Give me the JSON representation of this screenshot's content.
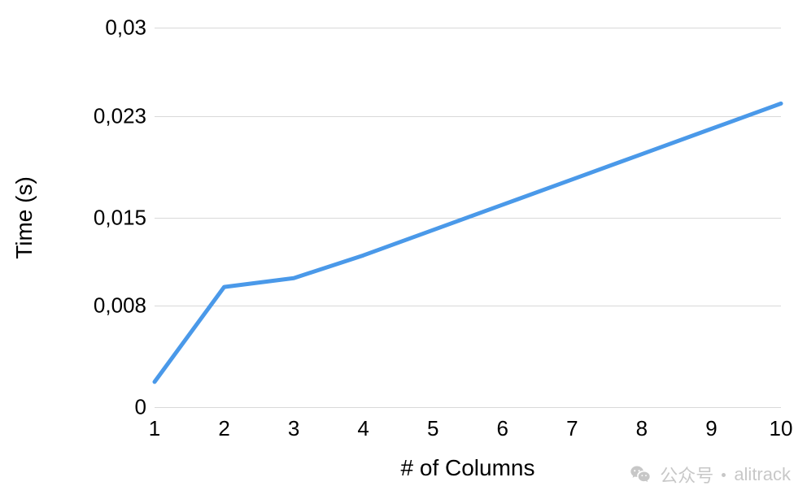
{
  "chart_data": {
    "type": "line",
    "x": [
      1,
      2,
      3,
      4,
      5,
      6,
      7,
      8,
      9,
      10
    ],
    "values": [
      0.002,
      0.0095,
      0.0102,
      0.012,
      0.014,
      0.016,
      0.018,
      0.02,
      0.022,
      0.024
    ],
    "xlabel": "# of Columns",
    "ylabel": "Time (s)",
    "ylim": [
      0,
      0.03
    ],
    "y_ticks": [
      0,
      0.008,
      0.015,
      0.023,
      0.03
    ],
    "y_tick_labels": [
      "0",
      "0,008",
      "0,015",
      "0,023",
      "0,03"
    ],
    "x_ticks": [
      1,
      2,
      3,
      4,
      5,
      6,
      7,
      8,
      9,
      10
    ],
    "x_tick_labels": [
      "1",
      "2",
      "3",
      "4",
      "5",
      "6",
      "7",
      "8",
      "9",
      "10"
    ],
    "line_color": "#4a99e9",
    "grid": true
  },
  "watermark": {
    "source_label": "公众号",
    "account": "alitrack"
  }
}
